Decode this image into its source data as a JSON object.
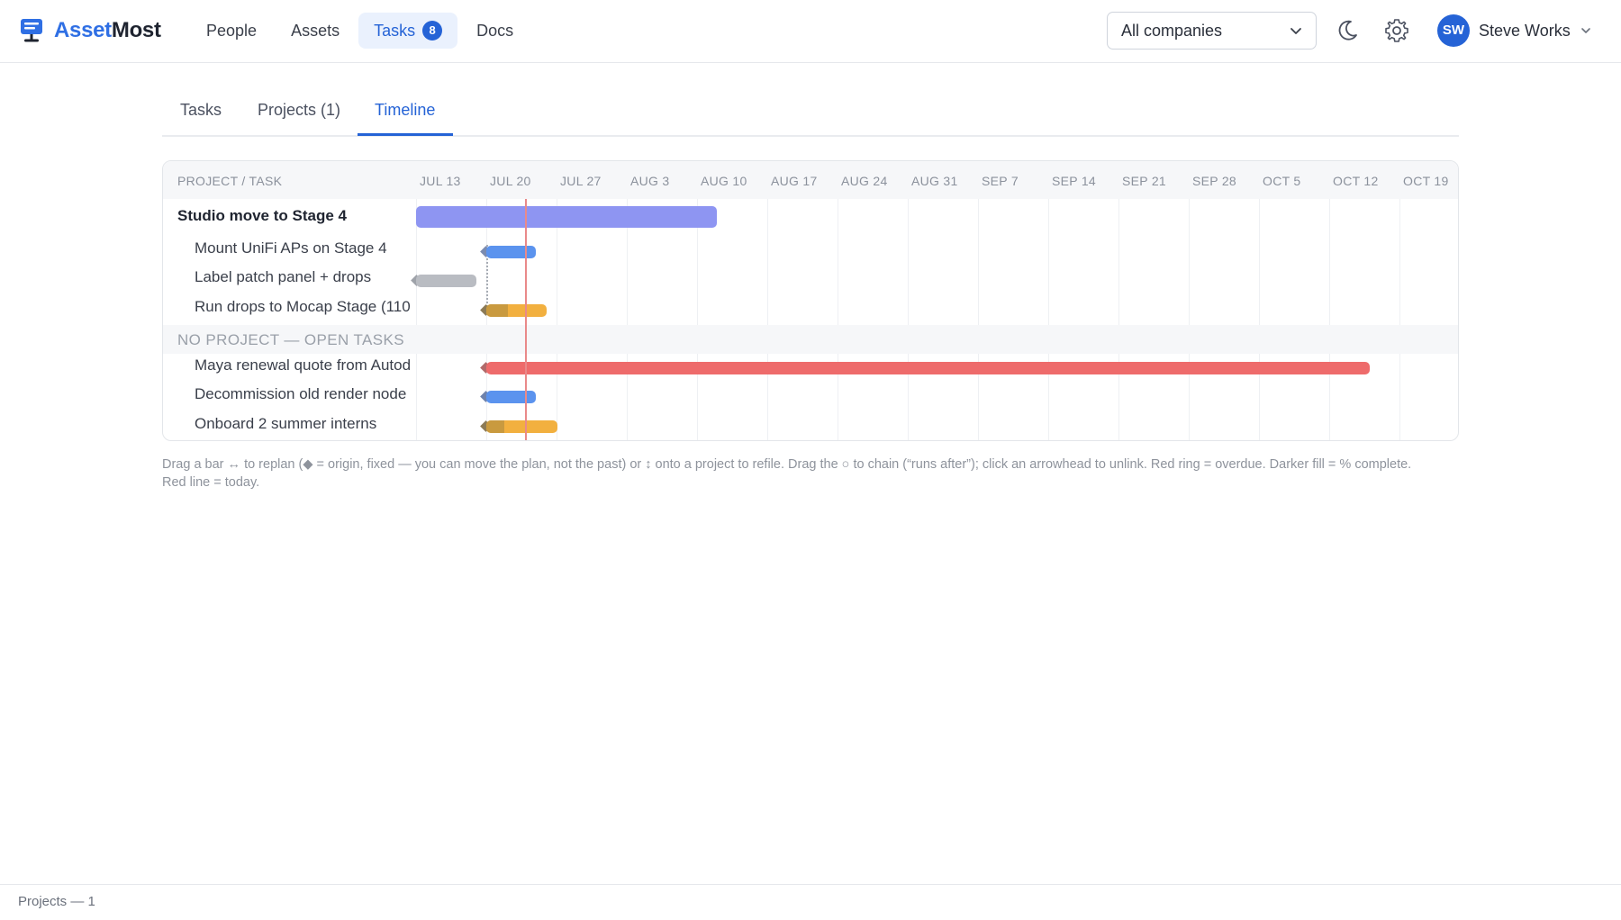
{
  "app": {
    "brand_part1": "Asset",
    "brand_part2": "Most",
    "accent_color": "#2563d6"
  },
  "nav": {
    "items": [
      {
        "label": "People"
      },
      {
        "label": "Assets"
      },
      {
        "label": "Tasks",
        "badge": "8",
        "active": true
      },
      {
        "label": "Docs"
      }
    ]
  },
  "company_select": {
    "value": "All companies",
    "icon": "chevron-down-icon"
  },
  "header_icons": [
    "moon-icon",
    "gear-icon"
  ],
  "user": {
    "initials": "SW",
    "name": "Steve Works"
  },
  "tabs": [
    {
      "label": "Tasks"
    },
    {
      "label": "Projects (1)"
    },
    {
      "label": "Timeline",
      "active": true
    }
  ],
  "timeline": {
    "column_header": "PROJECT / TASK",
    "weeks": [
      "JUL 13",
      "JUL 20",
      "JUL 27",
      "AUG 3",
      "AUG 10",
      "AUG 17",
      "AUG 24",
      "AUG 31",
      "SEP 7",
      "SEP 14",
      "SEP 21",
      "SEP 28",
      "OCT 5",
      "OCT 12",
      "OCT 19"
    ],
    "project": {
      "label": "Studio move to Stage 4"
    },
    "project_tasks": [
      {
        "label": "Mount UniFi APs on Stage 4"
      },
      {
        "label": "Label patch panel + drops"
      },
      {
        "label": "Run drops to Mocap Stage (110"
      }
    ],
    "group_label": "NO PROJECT — OPEN TASKS",
    "open_tasks": [
      {
        "label": "Maya renewal quote from Autod"
      },
      {
        "label": "Decommission old render node"
      },
      {
        "label": "Onboard 2 summer interns"
      }
    ],
    "bar_colors": {
      "project": "#8e95f2",
      "blue": "#5b93ee",
      "gray": "#b9bcc2",
      "orange": "#f2b03f",
      "orange_done": "#c99a3f",
      "red": "#ee6b6b",
      "today": "#e98a8a"
    }
  },
  "help_text": "Drag a bar ↔ to replan (◆ = origin, fixed — you can move the plan, not the past) or ↕ onto a project to refile. Drag the ○ to chain (“runs after”); click an arrowhead to unlink. Red ring = overdue. Darker fill = % complete. Red line = today.",
  "footer": {
    "text": "Projects — 1"
  }
}
